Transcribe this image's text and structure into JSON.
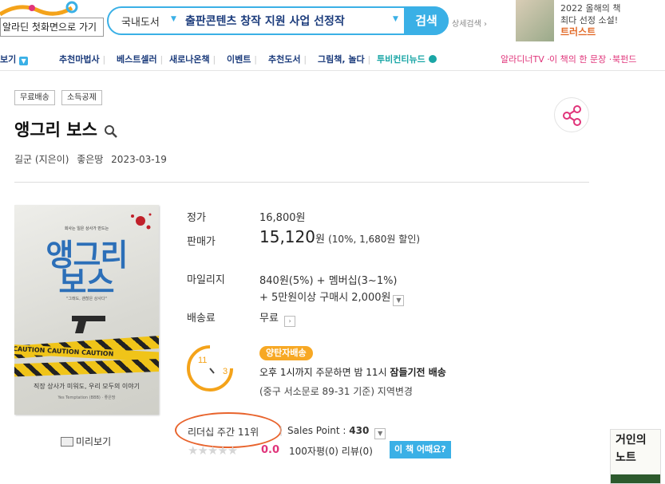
{
  "header": {
    "home_link": "알라딘 첫화면으로 가기",
    "search": {
      "category": "국내도서",
      "query": "출판콘텐츠 창작 지원 사업 선정작",
      "button": "검색",
      "advanced": "상세검색"
    },
    "ad": {
      "line1": "2022 올해의 책",
      "line2": "최다 선정 소설!",
      "line3": "트러스트"
    }
  },
  "nav": {
    "items": [
      "보기",
      "추천마법사",
      "베스트셀러",
      "새로나온책",
      "이벤트",
      "추천도서",
      "그림책, 놀다",
      "투비컨티뉴드"
    ],
    "right": [
      "알라디너TV",
      "이 책의 한 문장",
      "북펀드"
    ]
  },
  "product": {
    "tags": [
      "무료배송",
      "소득공제"
    ],
    "title": "앵그리 보스",
    "author": "길군 (지은이)",
    "publisher": "좋은땅",
    "date": "2023-03-19",
    "cover": {
      "top_text": "회사는 일은 상사가 만드는",
      "title_line1": "앵그리",
      "title_line2": "보스",
      "quote": "\"그래도, 괜찮은 상사다\"",
      "tape_text": "CAUTION  CAUTION  CAUTION",
      "subtitle": "직장 상사가 미워도, 우리 모두의 이야기",
      "publisher_mark": "Yes Temptation (BBB) · 좋은땅"
    },
    "preview_label": "미리보기"
  },
  "price": {
    "list_label": "정가",
    "list_value": "16,800원",
    "sale_label": "판매가",
    "sale_value": "15,120",
    "sale_unit": "원",
    "sale_detail": "(10%, 1,680원 할인)",
    "mileage_label": "마일리지",
    "mileage_value": "840원(5%) + 멤버십(3~1%)",
    "mileage_extra": "+ 5만원이상 구매시 2,000원",
    "shipping_label": "배송료",
    "shipping_value": "무료"
  },
  "delivery": {
    "clock_from": "11",
    "clock_to": "3",
    "badge": "양탄자배송",
    "line1_pre": "오후 1시까지 주문하면 밤 11시 ",
    "line1_bold": "잠들기전 배송",
    "line2": "(중구 서소문로 89-31 기준) 지역변경"
  },
  "stats": {
    "rank": "리더십 주간 11위",
    "sales_point_label": "Sales Point : ",
    "sales_point_value": "430",
    "stars": "★★★★★",
    "star_score": "0.0",
    "reviews": "100자평(0)   리뷰(0)",
    "how_button": "이 책 어때요?"
  },
  "side_ad": {
    "line1": "거인의",
    "line2": "노트"
  },
  "colors": {
    "accent": "#3ab0e6",
    "pink": "#e0347a",
    "orange": "#e8632c",
    "badge": "#f7a824"
  }
}
